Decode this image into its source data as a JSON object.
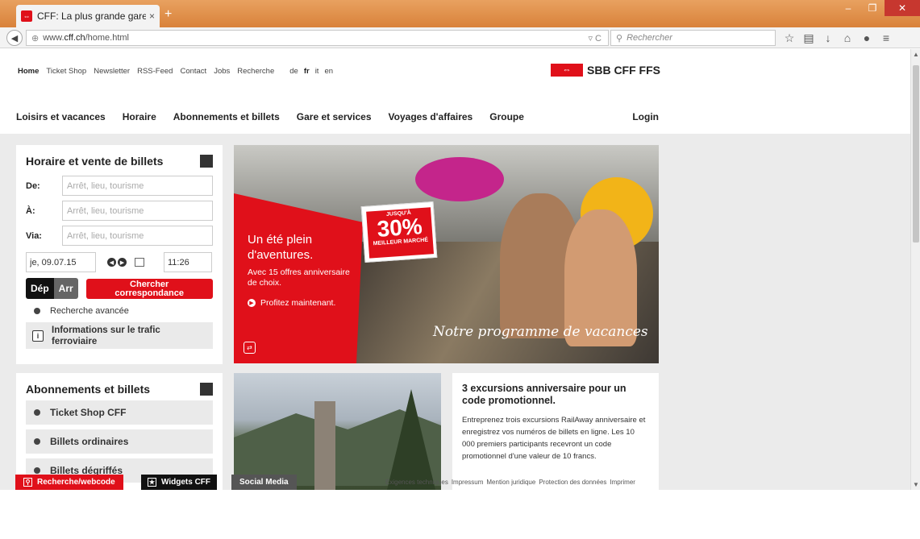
{
  "browser": {
    "tab_title": "CFF: La plus grande gare d...",
    "tab_close": "×",
    "new_tab": "+",
    "url_prefix": "www.",
    "url_domain": "cff.ch",
    "url_path": "/home.html",
    "search_placeholder": "Rechercher",
    "accent": "#e08b3c"
  },
  "meta_nav": {
    "home": "Home",
    "items": [
      "Ticket Shop",
      "Newsletter",
      "RSS-Feed",
      "Contact",
      "Jobs",
      "Recherche"
    ],
    "languages": [
      "de",
      "fr",
      "it",
      "en"
    ],
    "current_language": "fr"
  },
  "logo": {
    "text": "SBB CFF FFS",
    "color": "#e0101a"
  },
  "main_nav": {
    "items": [
      "Loisirs et vacances",
      "Horaire",
      "Abonnements et billets",
      "Gare et services",
      "Voyages d'affaires",
      "Groupe"
    ],
    "login": "Login"
  },
  "timetable": {
    "title": "Horaire et vente de billets",
    "from_label": "De:",
    "to_label": "À:",
    "via_label": "Via:",
    "placeholder": "Arrêt, lieu, tourisme",
    "date": "je, 09.07.15",
    "time": "11:26",
    "dep": "Dép",
    "arr": "Arr",
    "search_line1": "Chercher",
    "search_line2": "correspondance",
    "advanced": "Recherche avancée",
    "info": "Informations sur le trafic ferroviaire"
  },
  "hero": {
    "badge_top": "JUSQU'À",
    "badge_pct": "30%",
    "badge_bottom": "MEILLEUR MARCHÉ",
    "headline": "Un été plein d'aventures.",
    "sub": "Avec 15 offres anniversaire de choix.",
    "cta": "Profitez maintenant.",
    "script": "Notre programme de vacances"
  },
  "subscriptions": {
    "title": "Abonnements et billets",
    "items": [
      "Ticket Shop CFF",
      "Billets ordinaires",
      "Billets dégriffés"
    ]
  },
  "promo": {
    "title": "3 excursions anniversaire pour un code promotionnel.",
    "body": "Entreprenez trois excursions RailAway anniversaire et enregistrez vos numéros de billets en ligne. Les 10 000 premiers participants recevront un code promotionnel d'une valeur de 10 francs."
  },
  "footer_bar": {
    "search_webcode": "Recherche/webcode",
    "widgets": "Widgets CFF",
    "social": "Social Media",
    "links": [
      "Exigences techniques",
      "Impressum",
      "Mention juridique",
      "Protection des données",
      "Imprimer"
    ]
  }
}
